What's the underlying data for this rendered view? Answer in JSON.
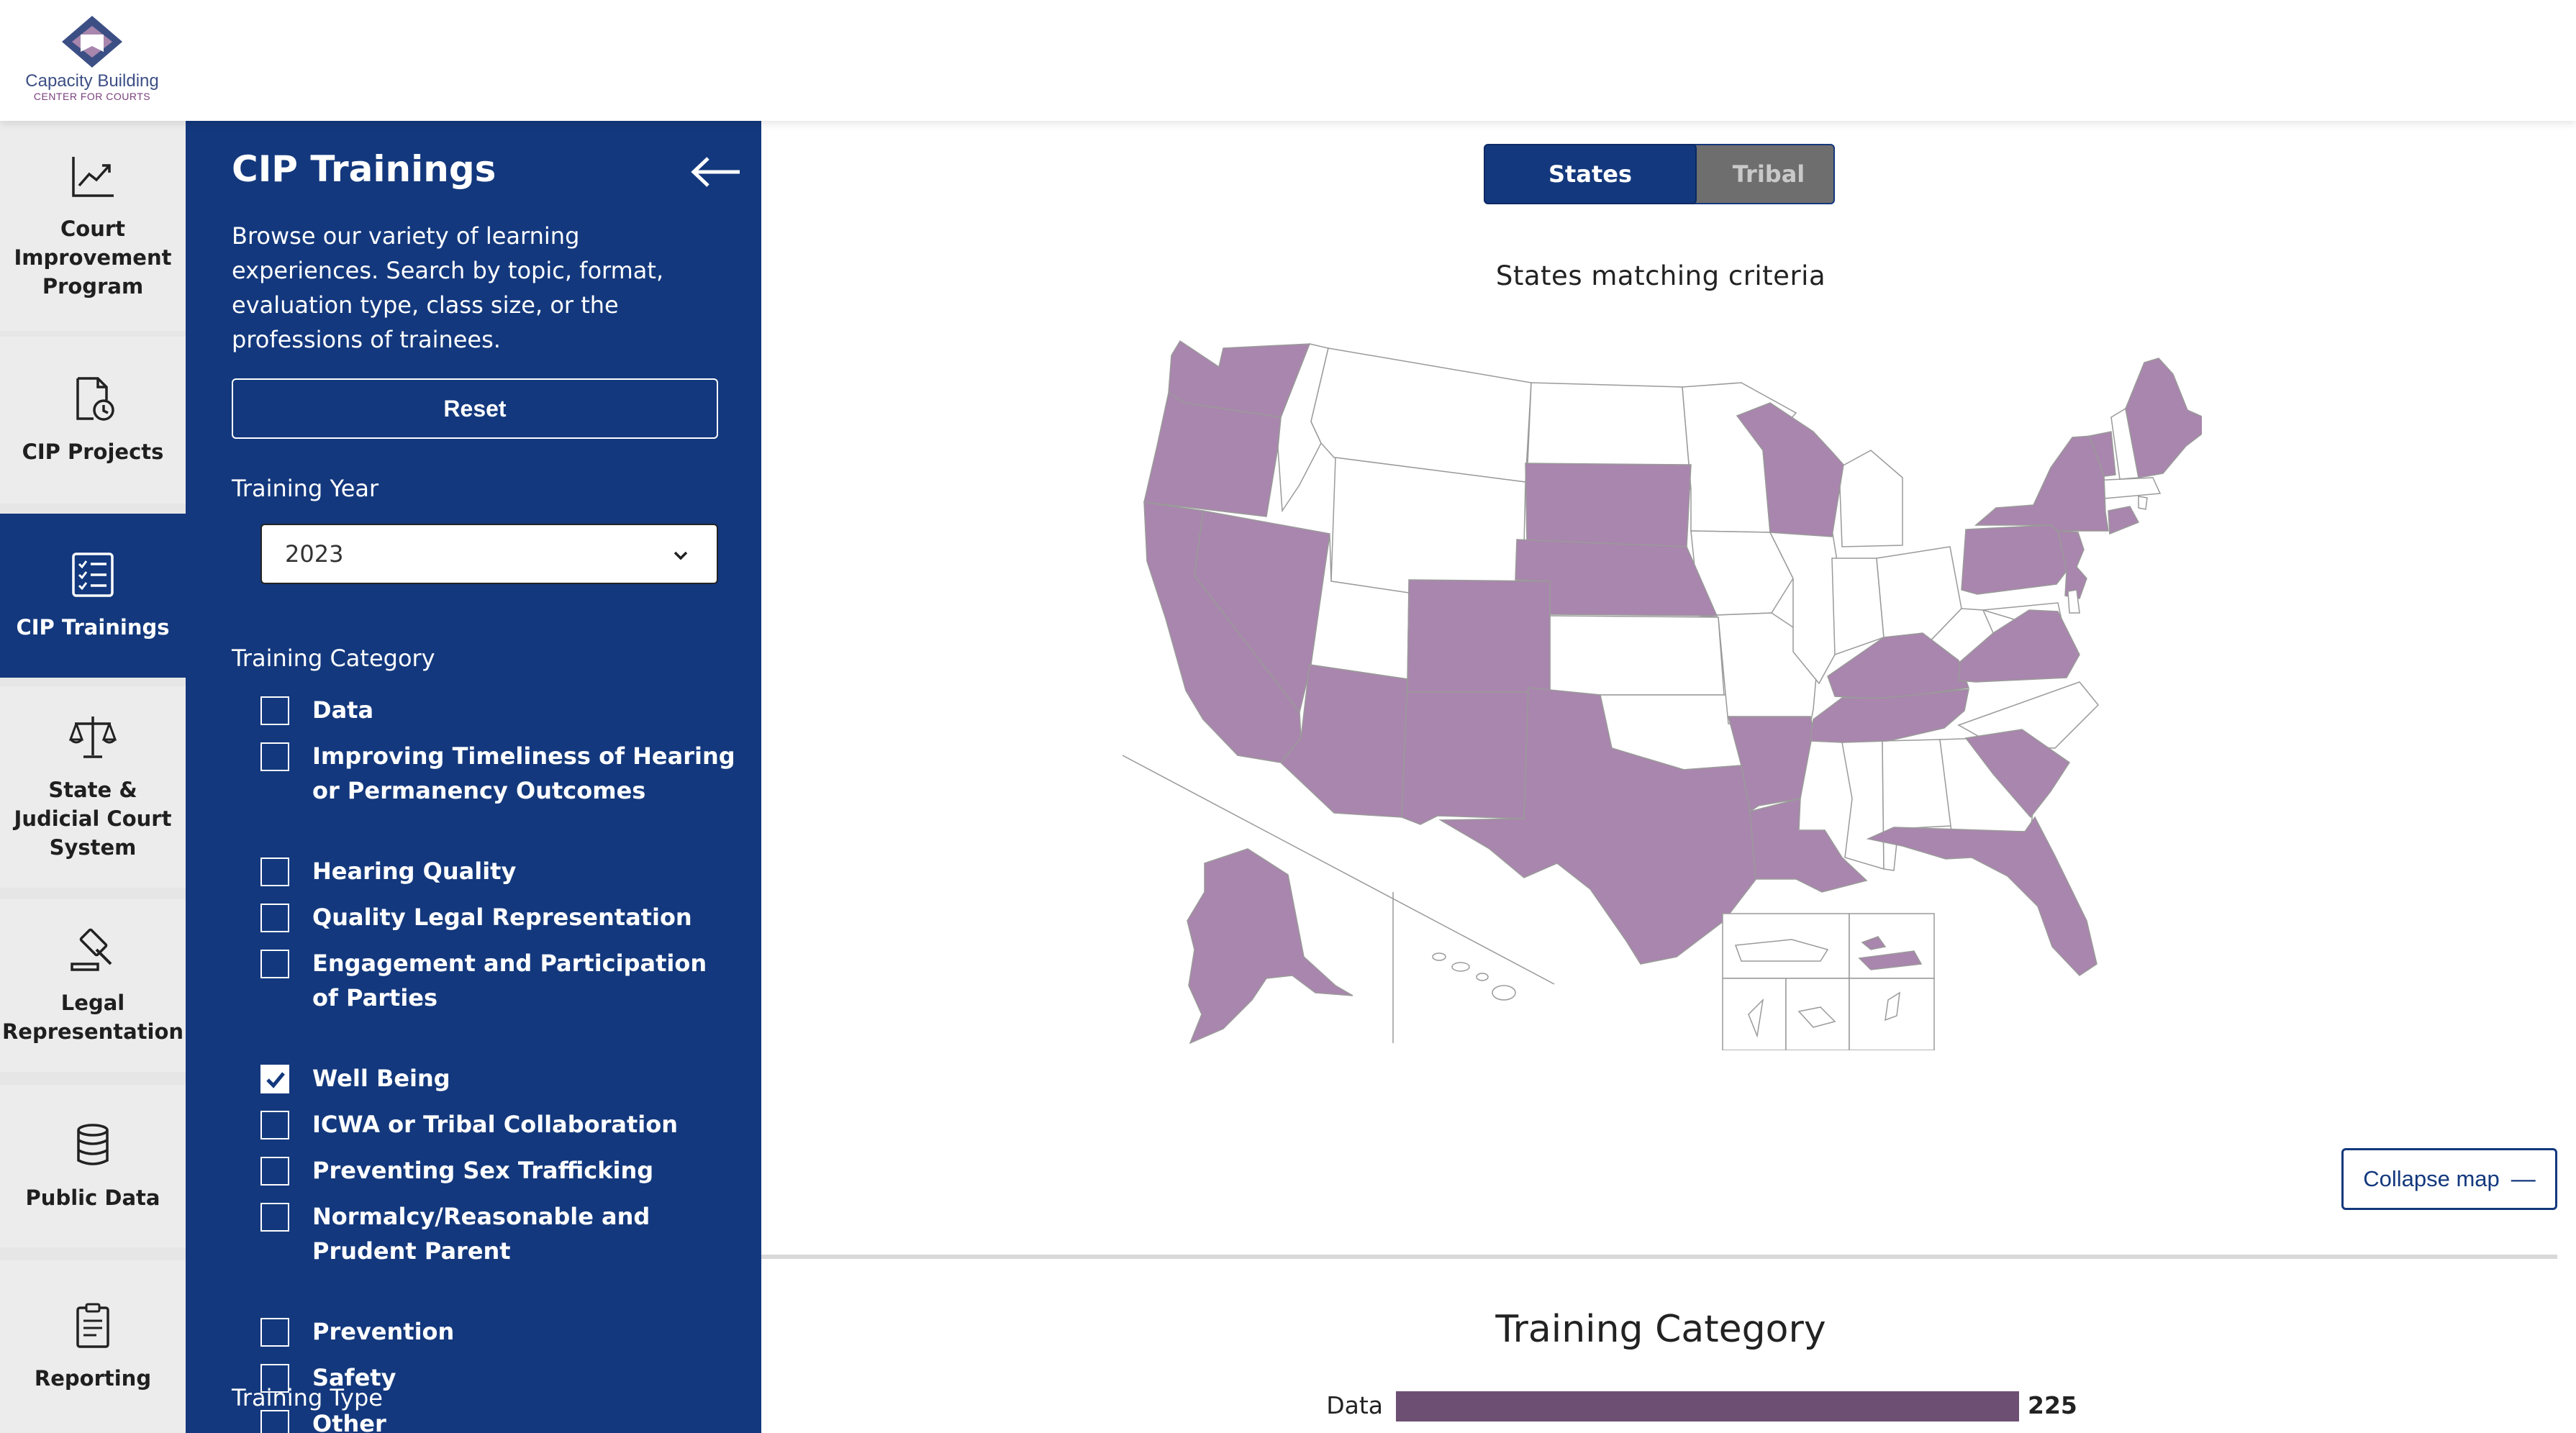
{
  "brand": {
    "logo_line1": "Capacity Building",
    "logo_line2": "CENTER FOR COURTS",
    "colors": {
      "navy": "#13387d",
      "purple": "#a986ad",
      "bar": "#6e4f74",
      "inactive": "#6e6e6e"
    }
  },
  "nav": {
    "items": [
      {
        "label": "Court Improvement Program",
        "icon": "line-chart-icon",
        "active": false
      },
      {
        "label": "CIP Projects",
        "icon": "document-clock-icon",
        "active": false
      },
      {
        "label": "CIP Trainings",
        "icon": "checklist-icon",
        "active": true
      },
      {
        "label": "State & Judicial Court System",
        "icon": "scales-icon",
        "active": false
      },
      {
        "label": "Legal Representation",
        "icon": "gavel-icon",
        "active": false
      },
      {
        "label": "Public Data",
        "icon": "database-icon",
        "active": false
      },
      {
        "label": "Reporting",
        "icon": "clipboard-icon",
        "active": false
      }
    ]
  },
  "panel": {
    "title": "CIP Trainings",
    "description": "Browse our variety of learning experiences. Search by topic, format, evaluation type, class size, or the professions of trainees.",
    "reset_label": "Reset",
    "year_label": "Training Year",
    "year_value": "2023",
    "category_label": "Training Category",
    "categories": [
      {
        "label": "Data",
        "checked": false
      },
      {
        "label": "Improving Timeliness of Hearing or Permanency Outcomes",
        "checked": false
      },
      {
        "label": "Hearing Quality",
        "checked": false
      },
      {
        "label": "Quality Legal Representation",
        "checked": false
      },
      {
        "label": "Engagement and Participation of Parties",
        "checked": false
      },
      {
        "label": "Well Being",
        "checked": true
      },
      {
        "label": "ICWA or Tribal Collaboration",
        "checked": false
      },
      {
        "label": "Preventing Sex Trafficking",
        "checked": false
      },
      {
        "label": "Normalcy/Reasonable and Prudent Parent",
        "checked": false
      },
      {
        "label": "Prevention",
        "checked": false
      },
      {
        "label": "Safety",
        "checked": false
      },
      {
        "label": "Other",
        "checked": false
      }
    ],
    "type_label": "Training Type"
  },
  "map": {
    "toggle_states": "States",
    "toggle_tribal": "Tribal",
    "caption": "States matching criteria",
    "collapse_label": "Collapse map",
    "collapse_icon": "minus-icon",
    "highlighted_states": [
      "WA",
      "OR",
      "CA",
      "NV",
      "AZ",
      "NM",
      "CO",
      "SD",
      "NE",
      "TX",
      "AR",
      "LA",
      "WI",
      "KY",
      "TN",
      "VA",
      "SC",
      "FL",
      "PA",
      "NY",
      "NJ",
      "VT",
      "ME",
      "CT",
      "AK",
      "VI"
    ]
  },
  "chart_data": {
    "type": "bar",
    "title": "Training Category",
    "categories": [
      "Data"
    ],
    "values": [
      225
    ]
  }
}
